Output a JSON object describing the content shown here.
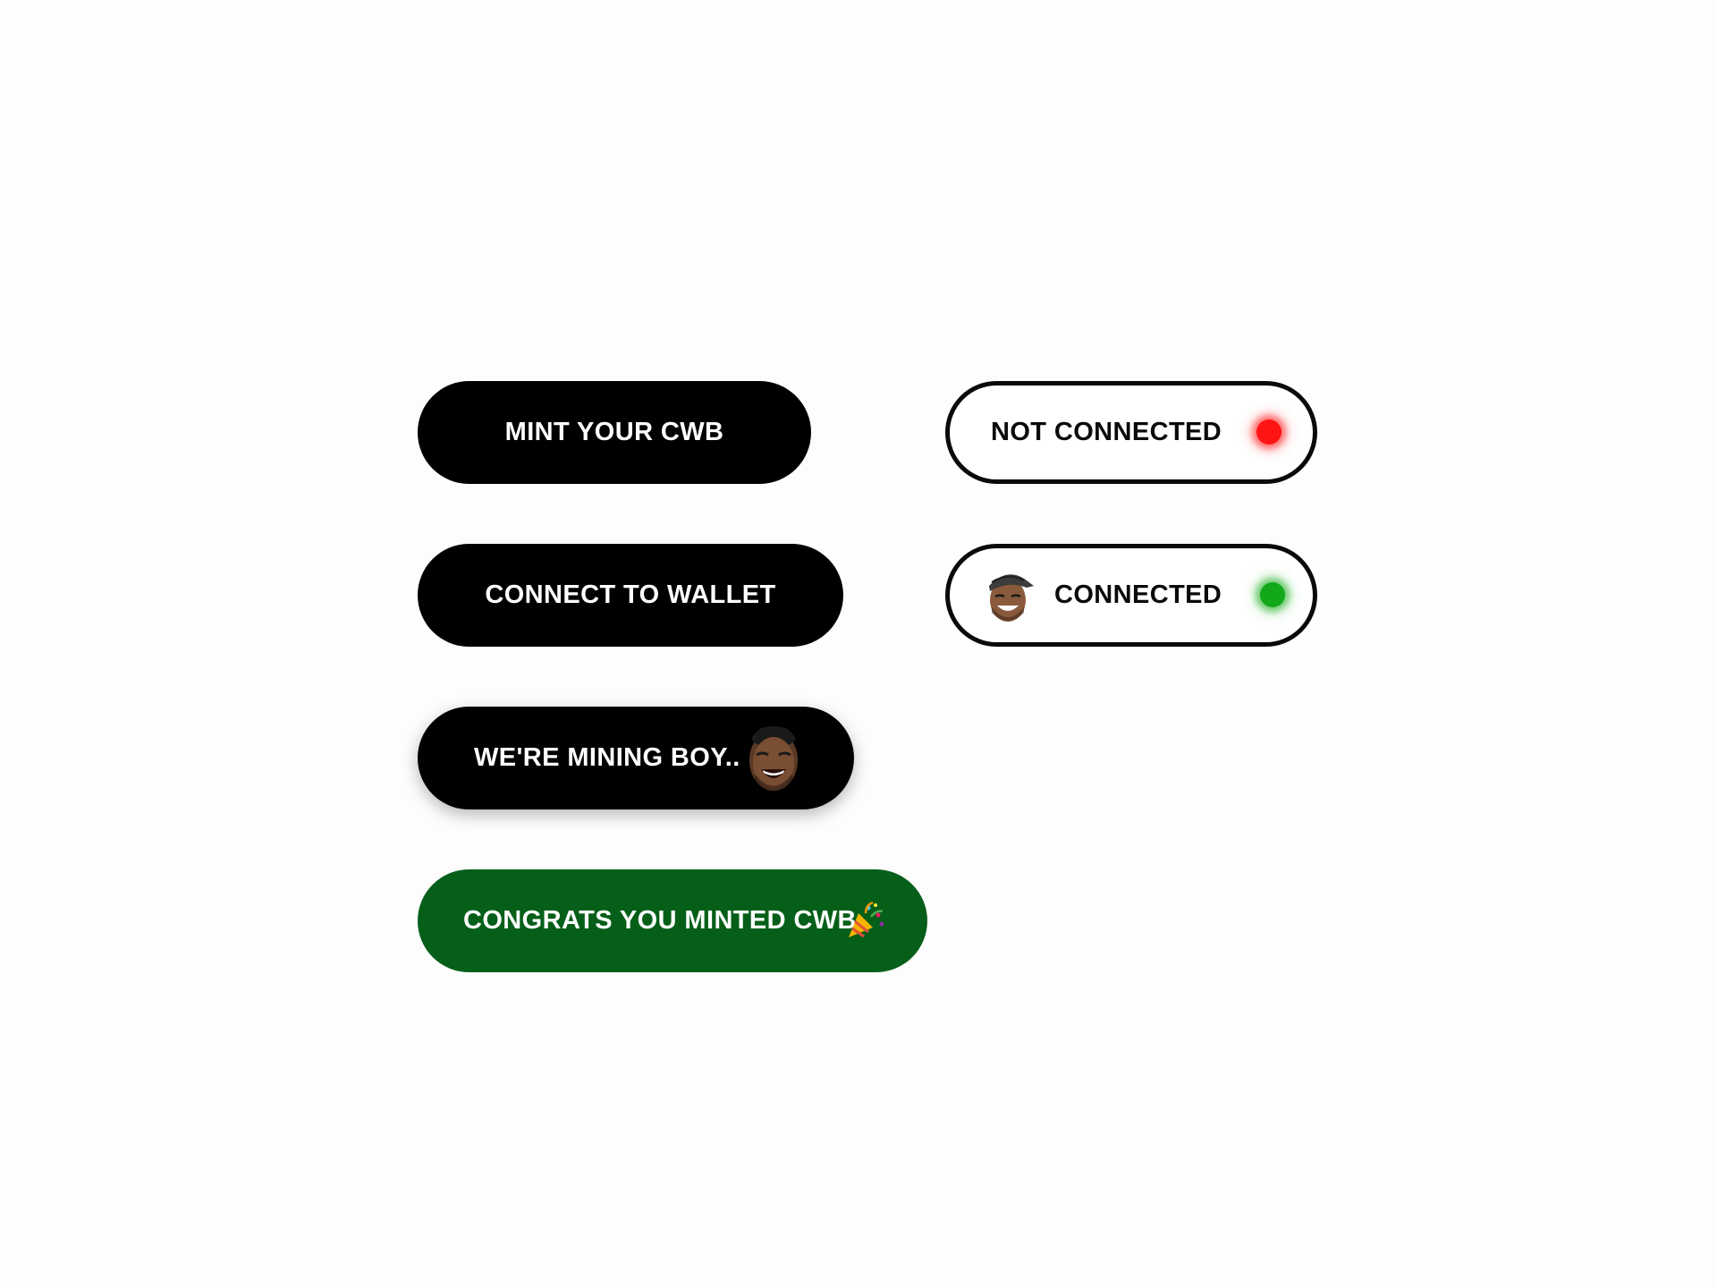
{
  "buttons": {
    "mint": {
      "label": "MINT YOUR CWB"
    },
    "connect": {
      "label": "CONNECT TO WALLET"
    },
    "mining": {
      "label": "WE'RE MINING BOY..",
      "icon": "drake-laughing-face-icon"
    },
    "congrats": {
      "label": "CONGRATS YOU MINTED CWB",
      "icon": "party-popper-icon"
    }
  },
  "status": {
    "not_connected": {
      "label": "NOT CONNECTED",
      "indicator": "red-status-dot",
      "color": "#ff1414"
    },
    "connected": {
      "label": "CONNECTED",
      "indicator": "green-status-dot",
      "color": "#12a81a",
      "avatar": "drake-avatar-icon"
    }
  },
  "colors": {
    "background": "#fdfdfd",
    "primary_button": "#000000",
    "success_button": "#065f19",
    "outline": "#0a0a0a"
  }
}
